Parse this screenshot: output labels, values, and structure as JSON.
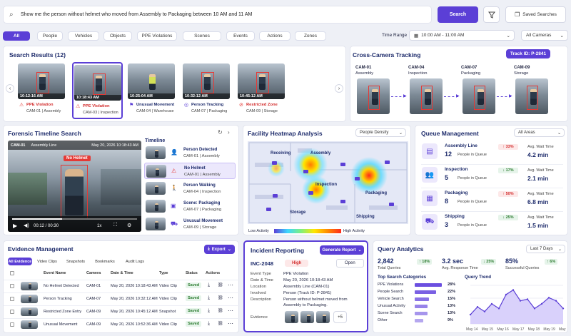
{
  "search": {
    "query": "Show me the person without helmet who moved from Assembly to Packaging between 10 AM and 11 AM",
    "button": "Search",
    "saved": "Saved Searches"
  },
  "filters": {
    "tabs": [
      "All",
      "People",
      "Vehicles",
      "Objects",
      "PPE Violations",
      "Scenes",
      "Events",
      "Actions",
      "Zones"
    ],
    "time_label": "Time Range",
    "time_value": "10:00 AM - 11:00 AM",
    "cameras": "All Cameras"
  },
  "results": {
    "title": "Search Results (12)",
    "items": [
      {
        "time": "10:12:16 AM",
        "label": "PPE Violation",
        "cam": "CAM-01 | Assembly",
        "kind": "alert"
      },
      {
        "time": "10:18:43 AM",
        "label": "PPE Violation",
        "cam": "CAM-03 | Inspection",
        "kind": "alert"
      },
      {
        "time": "10:25:04 AM",
        "label": "Unusual Movement",
        "cam": "CAM-04 | Warehouse",
        "kind": "move"
      },
      {
        "time": "10:32:12 AM",
        "label": "Person Tracking",
        "cam": "CAM-07 | Packaging",
        "kind": "track"
      },
      {
        "time": "10:45:12 AM",
        "label": "Restricted Zone",
        "cam": "CAM-09 | Storage",
        "kind": "zone"
      }
    ]
  },
  "tracking": {
    "title": "Cross-Camera Tracking",
    "track_id": "Track ID: P-2841",
    "cams": [
      {
        "cam": "CAM-01",
        "zone": "Assembly"
      },
      {
        "cam": "CAM-04",
        "zone": "Inspection"
      },
      {
        "cam": "CAM-07",
        "zone": "Packaging"
      },
      {
        "cam": "CAM-09",
        "zone": "Storage"
      }
    ]
  },
  "forensic": {
    "title": "Forensic Timeline Search",
    "cam": "CAM-01",
    "zone": "Assembly Line",
    "date": "May 20, 2026 10:18:43 AM",
    "tag": "No Helmet",
    "time": "00:12 / 00:30",
    "speed": "1x",
    "timeline_title": "Timeline",
    "events": [
      {
        "name": "Person Detected",
        "cam": "CAM-01 | Assembly"
      },
      {
        "name": "No Helmet",
        "cam": "CAM-01 | Assembly"
      },
      {
        "name": "Person Walking",
        "cam": "CAM-04 | Inspection"
      },
      {
        "name": "Scene: Packaging",
        "cam": "CAM-07 | Packaging"
      },
      {
        "name": "Unusual Movement",
        "cam": "CAM-09 | Storage"
      }
    ]
  },
  "heatmap": {
    "title": "Facility Heatmap Analysis",
    "select": "People Density",
    "zones": [
      "Receiving",
      "Assembly",
      "Inspection",
      "Packaging",
      "Storage",
      "Shipping"
    ],
    "low": "Low Activity",
    "high": "High Activity"
  },
  "queue": {
    "title": "Queue Management",
    "select": "All Areas",
    "people_label": "People in Queue",
    "wait_label": "Avg. Wait Time",
    "rows": [
      {
        "name": "Assembly Line",
        "count": "12",
        "change": "33%",
        "dir": "up",
        "wait": "4.2 min",
        "icon": "assembly-icon"
      },
      {
        "name": "Inspection",
        "count": "5",
        "change": "17%",
        "dir": "down",
        "wait": "2.1 min",
        "icon": "inspection-icon"
      },
      {
        "name": "Packaging",
        "count": "8",
        "change": "50%",
        "dir": "up",
        "wait": "6.8 min",
        "icon": "packaging-icon"
      },
      {
        "name": "Shipping",
        "count": "3",
        "change": "25%",
        "dir": "down",
        "wait": "1.5 min",
        "icon": "truck-icon"
      }
    ]
  },
  "evidence": {
    "title": "Evidence Management",
    "export": "Export",
    "tabs": [
      "All Evidence",
      "Video Clips",
      "Snapshots",
      "Bookmarks",
      "Audit Logs"
    ],
    "headers": [
      "Event Name",
      "Camera",
      "Date & Time",
      "Type",
      "Status",
      "Actions"
    ],
    "rows": [
      {
        "name": "No Helmet Detected",
        "cam": "CAM-01",
        "date": "May 20, 2026 10:18:43 AM",
        "type": "Video Clip",
        "status": "Saved"
      },
      {
        "name": "Person Tracking",
        "cam": "CAM-07",
        "date": "May 20, 2026 10:32:12 AM",
        "type": "Video Clip",
        "status": "Saved"
      },
      {
        "name": "Restricted Zone Entry",
        "cam": "CAM-09",
        "date": "May 20, 2026 10:45:12 AM",
        "type": "Snapshot",
        "status": "Saved"
      },
      {
        "name": "Unusual Movement",
        "cam": "CAM-09",
        "date": "May 20, 2026 10:52:36 AM",
        "type": "Video Clip",
        "status": "Saved"
      }
    ]
  },
  "incident": {
    "title": "Incident Reporting",
    "button": "Generate Report",
    "id": "INC-2048",
    "severity": "High",
    "state": "Open",
    "fields": [
      {
        "k": "Event Type",
        "v": "PPE Violation"
      },
      {
        "k": "Date & Time",
        "v": "May 20, 2026 10:18:43 AM"
      },
      {
        "k": "Location",
        "v": "Assembly Line (CAM-01)"
      },
      {
        "k": "Involved",
        "v": "Person (Track ID: P-2841)"
      },
      {
        "k": "Description",
        "v": "Person without helmet moved from Assembly to Packaging."
      }
    ],
    "evidence_label": "Evidence",
    "more": "+5"
  },
  "analytics": {
    "title": "Query Analytics",
    "range": "Last 7 Days",
    "stats": [
      {
        "value": "2,842",
        "label": "Total Queries",
        "change": "18%"
      },
      {
        "value": "3.2 sec",
        "label": "Avg. Response Time",
        "change": "25%"
      },
      {
        "value": "85%",
        "label": "Successful Queries",
        "change": "6%"
      }
    ],
    "cat_title": "Top Search Categories",
    "trend_title": "Query Trend",
    "categories": [
      {
        "name": "PPE Violations",
        "pct": "28%",
        "v": 28
      },
      {
        "name": "People Search",
        "pct": "22%",
        "v": 22
      },
      {
        "name": "Vehicle Search",
        "pct": "15%",
        "v": 15
      },
      {
        "name": "Unusual Activity",
        "pct": "13%",
        "v": 13
      },
      {
        "name": "Scene Search",
        "pct": "13%",
        "v": 13
      },
      {
        "name": "Other",
        "pct": "9%",
        "v": 9
      }
    ],
    "trend_x": [
      "May 14",
      "May 15",
      "May 16",
      "May 17",
      "May 18",
      "May 19",
      "May 20"
    ],
    "trend_values": [
      260,
      310,
      280,
      330,
      300,
      390,
      420,
      350,
      360,
      300,
      330,
      370,
      350,
      300
    ]
  },
  "colors": {
    "accent": "#5b3fd6",
    "navy": "#1d2b6b",
    "danger": "#e53935",
    "success": "#2e7d32"
  }
}
